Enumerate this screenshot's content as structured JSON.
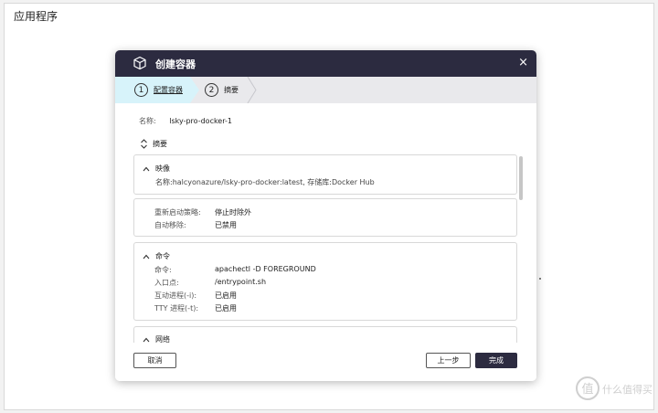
{
  "page": {
    "title": "应用程序"
  },
  "colors": {
    "header": "#2c2b40",
    "active_step": "#d7f3fa",
    "steps_bar": "#e9e9ec",
    "primary_button": "#2c2b40"
  },
  "modal": {
    "title": "创建容器",
    "icon": "cube-icon",
    "close_glyph": "×",
    "steps": [
      {
        "number": "1",
        "label": "配置容器",
        "active": true
      },
      {
        "number": "2",
        "label": "摘要",
        "active": false
      }
    ],
    "name_label": "名称:",
    "name_value": "lsky-pro-docker-1",
    "summary_toggle": "摘要",
    "sections": {
      "image": {
        "title": "映像",
        "line": "名称:halcyonazure/lsky-pro-docker:latest, 存储库:Docker Hub"
      },
      "restart": {
        "rows": [
          {
            "key": "重新启动策略:",
            "value": "停止时除外"
          },
          {
            "key": "自动移除:",
            "value": "已禁用"
          }
        ]
      },
      "command": {
        "title": "命令",
        "rows": [
          {
            "key": "命令:",
            "value": "apachectl -D FOREGROUND"
          },
          {
            "key": "入口点:",
            "value": "/entrypoint.sh"
          },
          {
            "key": "互动进程(-i):",
            "value": "已启用"
          },
          {
            "key": "TTY 进程(-t):",
            "value": "已启用"
          }
        ]
      },
      "network": {
        "title": "网络"
      }
    },
    "footer": {
      "cancel": "取消",
      "previous": "上一步",
      "finish": "完成"
    }
  },
  "watermark": {
    "line1": "值",
    "line2": "什么值得买"
  }
}
